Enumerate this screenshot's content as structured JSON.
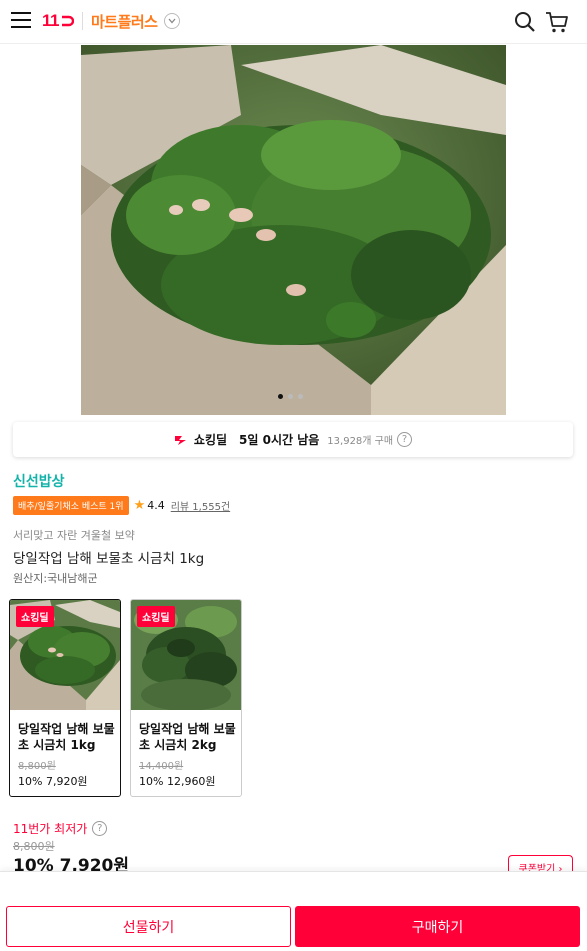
{
  "header": {
    "logo_text": "11",
    "mart_label": "마트플러스",
    "accent_red": "#ff0038",
    "accent_orange": "#ff7a1a"
  },
  "hero": {
    "image_desc": "spinach-in-cardboard-box",
    "slide_count": 3,
    "active_slide": 1
  },
  "deal_bar": {
    "label": "쇼킹딜",
    "time_left": "5일 0시간 남음",
    "sold": "13,928개 구매",
    "help": "?"
  },
  "product": {
    "seller": "신선밥상",
    "best_badge": "배추/잎줄기채소 베스트 1위",
    "rating": "4.4",
    "review": "리뷰 1,555건",
    "subtitle": "서리맞고 자란 겨울철 보약",
    "title": "당일작업 남해 보물초 시금치 1kg",
    "origin": "원산지:국내남해군"
  },
  "options": [
    {
      "tag": "쇼킹딜",
      "name": "당일작업 남해 보물초 시금치 1kg",
      "orig_price": "8,800원",
      "price": "10% 7,920원",
      "selected": true
    },
    {
      "tag": "쇼킹딜",
      "name": "당일작업 남해 보물초 시금치 2kg",
      "orig_price": "14,400원",
      "price": "10% 12,960원",
      "selected": false
    }
  ],
  "price": {
    "lowest_label": "11번가 최저가",
    "help": "?",
    "orig": "8,800원",
    "final": "10% 7,920원",
    "coupon": "쿠폰받기 ›"
  },
  "bottom": {
    "gift": "선물하기",
    "buy": "구매하기"
  }
}
